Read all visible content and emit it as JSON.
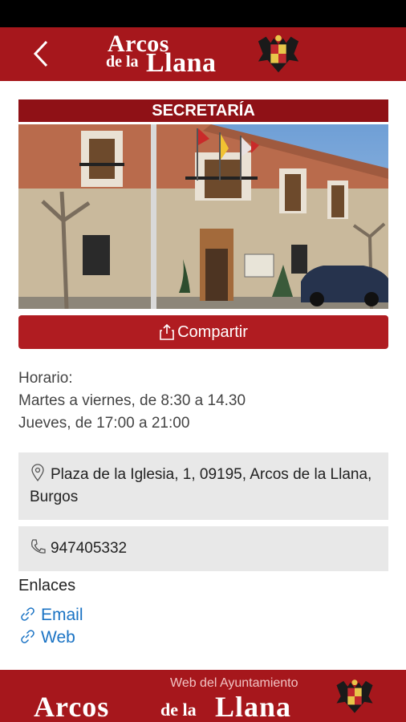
{
  "header": {
    "logo_line1": "Arcos",
    "logo_line2a": "de la",
    "logo_line2b": "Llana",
    "back_icon": "chevron-left-icon",
    "crest_icon": "coat-of-arms-icon"
  },
  "section": {
    "title": "SECRETARÍA"
  },
  "actions": {
    "share_label": "Compartir",
    "share_icon": "share-icon"
  },
  "hours": {
    "heading": "Horario:",
    "lines": [
      "Martes a viernes, de 8:30 a 14.30",
      "Jueves, de 17:00 a 21:00"
    ]
  },
  "contact": {
    "address": "Plaza de la Iglesia, 1, 09195, Arcos de la Llana, Burgos",
    "address_icon": "map-pin-icon",
    "phone": "947405332",
    "phone_icon": "phone-icon"
  },
  "links": {
    "heading": "Enlaces",
    "items": [
      {
        "label": "Email",
        "icon": "link-icon"
      },
      {
        "label": "Web",
        "icon": "link-icon"
      }
    ]
  },
  "footer": {
    "tagline": "Web del Ayuntamiento",
    "name_part1": "Arcos",
    "name_part2": "de la",
    "name_part3": "Llana"
  },
  "colors": {
    "brand_red": "#a6171c",
    "title_red": "#8f1116",
    "link_blue": "#1a73c4",
    "box_gray": "#e8e8e8"
  }
}
